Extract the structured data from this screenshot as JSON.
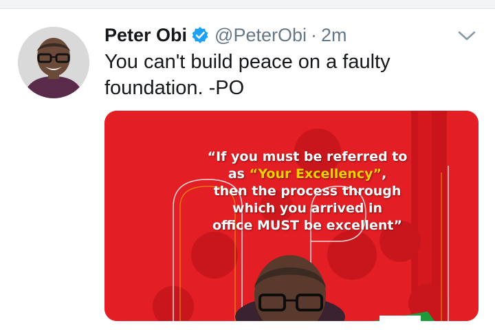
{
  "tweet": {
    "author_name": "Peter Obi",
    "handle": "@PeterObi",
    "separator": "·",
    "timestamp": "2m",
    "verified": true,
    "verified_icon": "verified-badge-icon",
    "menu_icon": "chevron-down-icon",
    "text": "You can't build peace on a faulty\nfoundation. -PO"
  },
  "media": {
    "quote_line1": "“If you must be referred to",
    "quote_line2_prefix": "as ",
    "quote_line2_highlight": "“Your Excellency”",
    "quote_line2_suffix": ",",
    "quote_line3": "then the process through",
    "quote_line4": "which you arrived in",
    "quote_line5": "office MUST be excellent”"
  },
  "colors": {
    "accent_blue": "#1da1f2",
    "banner_red": "#e31e24",
    "highlight_yellow": "#f5d000",
    "text_primary": "#14171a",
    "text_secondary": "#657786"
  }
}
